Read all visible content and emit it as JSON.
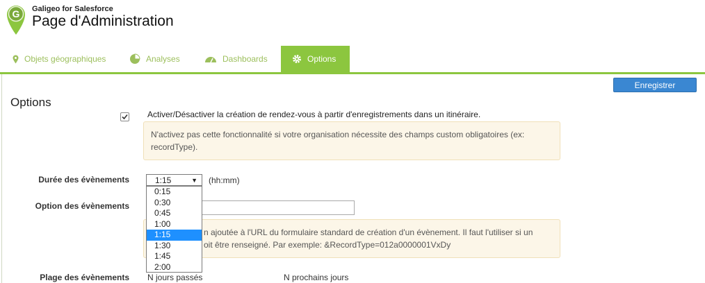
{
  "header": {
    "app_name": "Galigeo for Salesforce",
    "page_title": "Page d'Administration"
  },
  "tabs": [
    {
      "label": "Objets géographiques",
      "icon": "map-pin-icon",
      "active": false
    },
    {
      "label": "Analyses",
      "icon": "pie-chart-icon",
      "active": false
    },
    {
      "label": "Dashboards",
      "icon": "gauge-icon",
      "active": false
    },
    {
      "label": "Options",
      "icon": "gear-icon",
      "active": true
    }
  ],
  "colors": {
    "accent": "#8cc63f",
    "tab_text": "#9cbf5c",
    "button": "#3a87d2",
    "warning_bg": "#fcf6e8"
  },
  "toolbar": {
    "save_label": "Enregistrer"
  },
  "section": {
    "title": "Options"
  },
  "option_activate": {
    "checked": true,
    "label": "Activer/Désactiver la création de rendez-vous à partir d'enregistrements dans un itinéraire.",
    "warning_line1": "N'activez pas cette fonctionnalité si votre organisation nécessite des champs custom obligatoires (ex:",
    "warning_line2": "recordType)."
  },
  "duration": {
    "label": "Durée des évènements",
    "selected": "1:15",
    "unit": "(hh:mm)",
    "options": [
      "0:15",
      "0:30",
      "0:45",
      "1:00",
      "1:15",
      "1:30",
      "1:45",
      "2:00"
    ]
  },
  "event_option": {
    "label": "Option des évènements",
    "value": "",
    "help_line1": "n ajoutée à l'URL du formulaire standard de création d'un évènement. Il faut l'utiliser si un",
    "help_line2": "oit être renseigné. Par exemple: &RecordType=012a0000001VxDy"
  },
  "range": {
    "label": "Plage des évènements",
    "past_label": "N jours passés",
    "next_label": "N prochains jours"
  }
}
